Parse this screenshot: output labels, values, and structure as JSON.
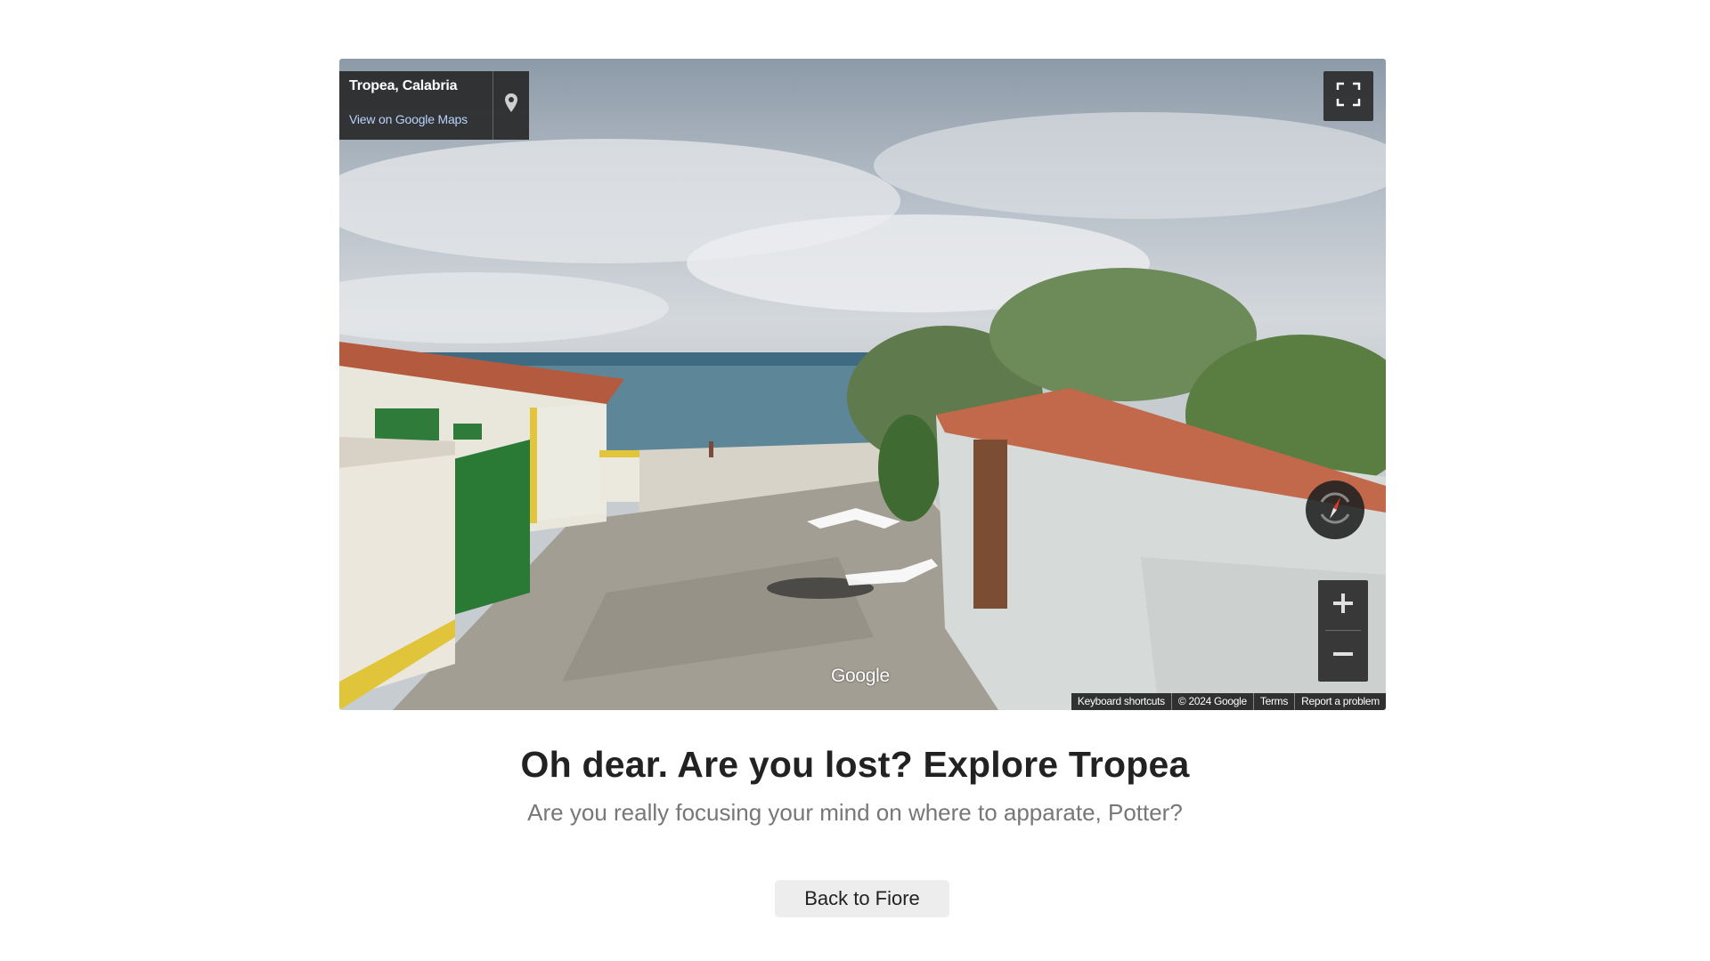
{
  "street_view": {
    "place_name": "Tropea, Calabria",
    "maps_link": "View on Google Maps",
    "watermark": "Google",
    "footer": {
      "keyboard": "Keyboard shortcuts",
      "copyright": "© 2024 Google",
      "terms": "Terms",
      "report": "Report a problem"
    },
    "icons": {
      "pin": "map-pin-icon",
      "fullscreen": "fullscreen-icon",
      "compass": "compass-icon",
      "zoom_in": "plus-icon",
      "zoom_out": "minus-icon"
    }
  },
  "message": {
    "headline": "Oh dear. Are you lost? Explore Tropea",
    "subline": "Are you really focusing your mind on where to apparate, Potter?"
  },
  "actions": {
    "back_label": "Back to Fiore"
  },
  "colors": {
    "control_bg": "#222222",
    "link": "#b9d3ff",
    "button_bg": "#ededed"
  }
}
